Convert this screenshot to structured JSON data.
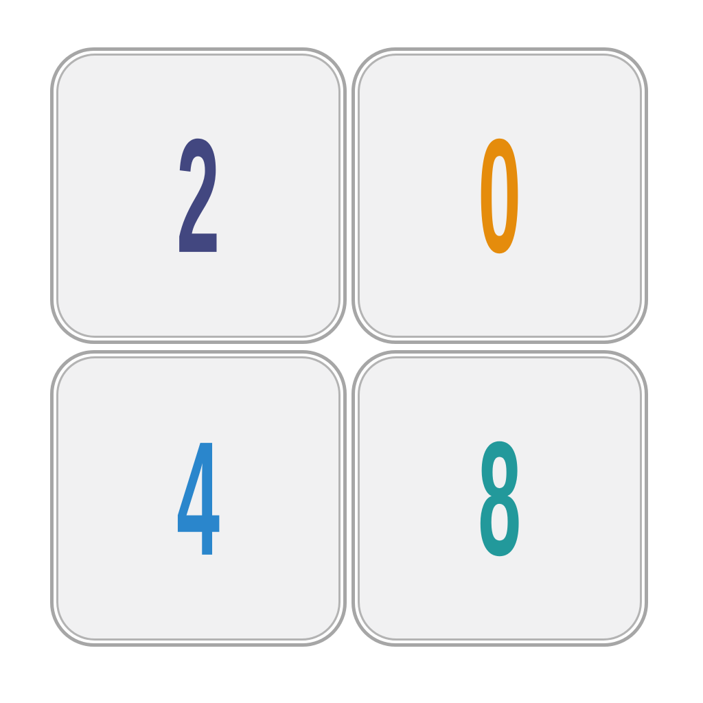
{
  "tiles": [
    {
      "value": "2",
      "color": "#424780"
    },
    {
      "value": "0",
      "color": "#e58c0c"
    },
    {
      "value": "4",
      "color": "#2a86cc"
    },
    {
      "value": "8",
      "color": "#22999b"
    }
  ],
  "colors": {
    "tile_border": "#a6a6a6",
    "tile_fill": "#f1f1f2",
    "background": "#ffffff"
  }
}
